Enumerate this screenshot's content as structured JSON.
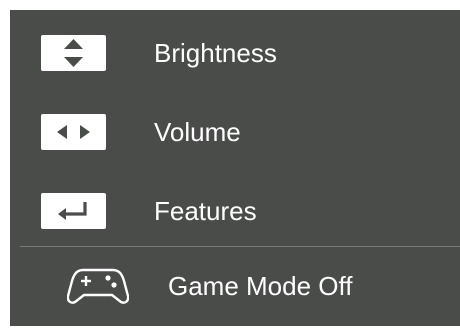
{
  "menu": {
    "items": [
      {
        "label": "Brightness",
        "icon": "up-down-arrows-icon"
      },
      {
        "label": "Volume",
        "icon": "left-right-arrows-icon"
      },
      {
        "label": "Features",
        "icon": "enter-return-icon"
      }
    ],
    "game_mode": {
      "label": "Game Mode Off",
      "icon": "gamepad-icon"
    }
  },
  "colors": {
    "background": "#4a4c4a",
    "key": "#ffffff",
    "text": "#ffffff",
    "divider": "#7a7c7a"
  }
}
